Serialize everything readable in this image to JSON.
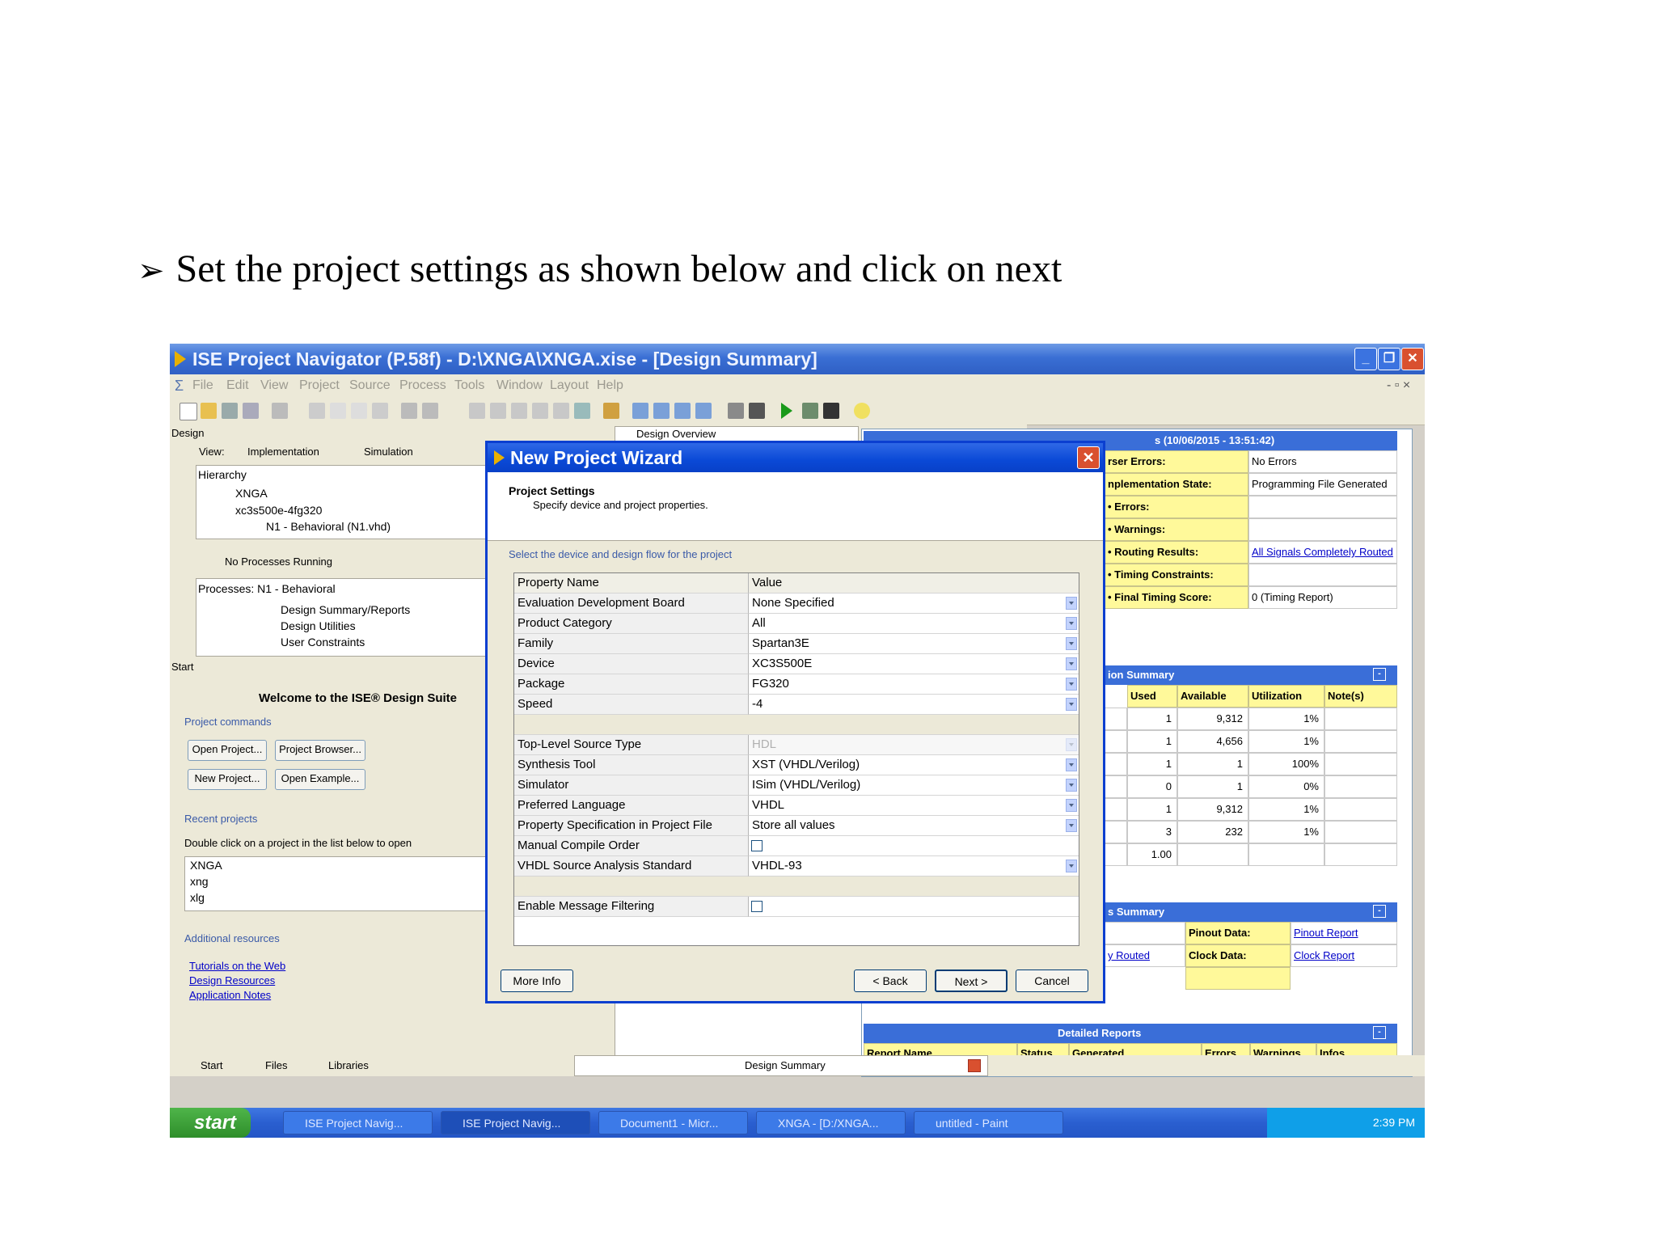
{
  "caption": {
    "bullet": "➢",
    "text": "Set the project settings as shown below and click on next"
  },
  "window": {
    "title": "ISE Project Navigator (P.58f) - D:\\XNGA\\XNGA.xise - [Design Summary]"
  },
  "menu": [
    "File",
    "Edit",
    "View",
    "Project",
    "Source",
    "Process",
    "Tools",
    "Window",
    "Layout",
    "Help"
  ],
  "design_panel": {
    "header": "Design",
    "view_label": "View:",
    "impl_label": "Implementation",
    "sim_label": "Simulation",
    "hierarchy_label": "Hierarchy",
    "tree": [
      "XNGA",
      "xc3s500e-4fg320",
      "N1 - Behavioral (N1.vhd)"
    ],
    "no_processes": "No Processes Running",
    "processes_label": "Processes: N1 - Behavioral",
    "process_items": [
      "Design Summary/Reports",
      "Design Utilities",
      "User Constraints"
    ]
  },
  "start_panel": {
    "header": "Start",
    "welcome": "Welcome to the ISE® Design Suite",
    "project_commands": "Project commands",
    "buttons": [
      "Open Project...",
      "Project Browser...",
      "New Project...",
      "Open Example..."
    ],
    "recent_label": "Recent projects",
    "recent_hint": "Double click on a project in the list below to open",
    "recent": [
      "XNGA",
      "xng",
      "xlg"
    ],
    "additional": "Additional resources",
    "links": [
      "Tutorials on the Web",
      "Design Resources",
      "Application Notes"
    ]
  },
  "mid_panel": {
    "header": "Design Overview"
  },
  "bottom_tabs": [
    "Start",
    "Files",
    "Libraries"
  ],
  "doc_tab": "Design Summary",
  "summary": {
    "title_fragment": "s (10/06/2015 - 13:51:42)",
    "rows": [
      {
        "label": "rser Errors:",
        "value": "No Errors"
      },
      {
        "label": "nplementation State:",
        "value": "Programming File Generated"
      },
      {
        "label": "• Errors:",
        "value": ""
      },
      {
        "label": "• Warnings:",
        "value": ""
      },
      {
        "label": "• Routing Results:",
        "value": "All Signals Completely Routed"
      },
      {
        "label": "• Timing Constraints:",
        "value": ""
      },
      {
        "label": "• Final Timing Score:",
        "value": "0  (Timing Report)"
      }
    ],
    "util_title": "ion Summary",
    "util_headers": [
      "Used",
      "Available",
      "Utilization",
      "Note(s)"
    ],
    "util_rows": [
      [
        "1",
        "9,312",
        "1%"
      ],
      [
        "1",
        "4,656",
        "1%"
      ],
      [
        "1",
        "1",
        "100%"
      ],
      [
        "0",
        "1",
        "0%"
      ],
      [
        "1",
        "9,312",
        "1%"
      ],
      [
        "3",
        "232",
        "1%"
      ],
      [
        "1.00",
        "",
        ""
      ]
    ],
    "partition_title": "s Summary",
    "pinout_label": "Pinout Data:",
    "pinout_link": "Pinout Report",
    "clock_label": "Clock Data:",
    "clock_link": "Clock Report",
    "routed_link": "y Routed",
    "detailed_title": "Detailed Reports",
    "detailed_headers": [
      "Report Name",
      "Status",
      "Generated",
      "Errors",
      "Warnings",
      "Infos"
    ]
  },
  "wizard": {
    "title": "New Project Wizard",
    "section": "Project Settings",
    "subtitle": "Specify device and project properties.",
    "group_label": "Select the device and design flow for the project",
    "header": {
      "name": "Property Name",
      "value": "Value"
    },
    "rows1": [
      {
        "name": "Evaluation Development Board",
        "value": "None Specified"
      },
      {
        "name": "Product Category",
        "value": "All"
      },
      {
        "name": "Family",
        "value": "Spartan3E"
      },
      {
        "name": "Device",
        "value": "XC3S500E"
      },
      {
        "name": "Package",
        "value": "FG320"
      },
      {
        "name": "Speed",
        "value": "-4"
      }
    ],
    "rows2": [
      {
        "name": "Top-Level Source Type",
        "value": "HDL"
      },
      {
        "name": "Synthesis Tool",
        "value": "XST (VHDL/Verilog)"
      },
      {
        "name": "Simulator",
        "value": "ISim (VHDL/Verilog)"
      },
      {
        "name": "Preferred Language",
        "value": "VHDL"
      },
      {
        "name": "Property Specification in Project File",
        "value": "Store all values"
      },
      {
        "name": "Manual Compile Order",
        "value": ""
      },
      {
        "name": "VHDL Source Analysis Standard",
        "value": "VHDL-93"
      }
    ],
    "row3": {
      "name": "Enable Message Filtering",
      "value": ""
    },
    "buttons": {
      "more_info": "More Info",
      "back": "< Back",
      "next": "Next >",
      "cancel": "Cancel"
    }
  },
  "taskbar": {
    "start": "start",
    "tasks": [
      "ISE Project Navig...",
      "ISE Project Navig...",
      "Document1 - Micr...",
      "XNGA - [D:/XNGA...",
      "untitled - Paint"
    ],
    "clock": "2:39 PM"
  },
  "colors": {
    "title_blue": "#3a6fd4",
    "dialog_blue": "#0a49d6",
    "summary_yellow": "#fff99a",
    "taskbar_blue": "#2a5fd0",
    "start_green": "#2e8e2a"
  }
}
